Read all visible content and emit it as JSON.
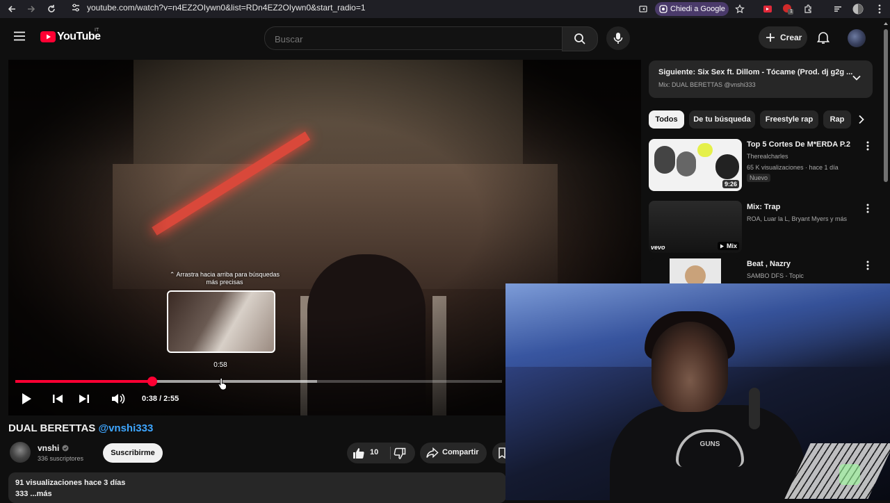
{
  "browser": {
    "url": "youtube.com/watch?v=n4EZ2OIywn0&list=RDn4EZ2OIywn0&start_radio=1",
    "ask_google_label": "Chiedi a Google",
    "extension_badge": "1"
  },
  "header": {
    "logo_text": "YouTube",
    "country_code": "IT",
    "search_placeholder": "Buscar",
    "create_label": "Crear"
  },
  "player": {
    "drag_hint": "⌃ Arrastra hacia arriba para búsquedas más precisas",
    "preview_time": "0:58",
    "time_display": "0:38 / 2:55",
    "progress_played_fraction": 0.281,
    "progress_buffered_fraction": 0.62
  },
  "video": {
    "title": "DUAL BERETTAS",
    "title_mention": "@vnshi333",
    "channel_name": "vnshi",
    "subscribers": "336 suscriptores",
    "subscribe_label": "Suscribirme",
    "likes": "10",
    "share_label": "Compartir",
    "stats": "91 visualizaciones  hace 3 días",
    "description_line": "333 ...más"
  },
  "queue": {
    "next_title": "Siguiente: Six Sex ft. Dillom - Tócame (Prod. dj g2g ...",
    "next_subtitle": "Mix: DUAL BERETTAS @vnshi333"
  },
  "chips": [
    "Todos",
    "De tu búsqueda",
    "Freestyle rap",
    "Rap"
  ],
  "recommendations": [
    {
      "title": "Top 5 Cortes De M*ERDA P.2",
      "channel": "Therealcharles",
      "meta": "65 K visualizaciones · hace 1 día",
      "badge": "Nuevo",
      "duration": "9:26"
    },
    {
      "title": "Mix: Trap",
      "channel": "ROA, Luar la L, Bryant Myers y más",
      "duration": "Mix",
      "thumb_brand": "vevo"
    },
    {
      "title": "Beat , Nazry",
      "channel": "SAMBO DFS - Topic"
    }
  ],
  "overlay": {
    "shirt_text": "GUNS"
  },
  "colors": {
    "accent_red": "#ff0033",
    "link_blue": "#3ea6ff",
    "background": "#0f0f0f",
    "chip_bg": "#272727"
  }
}
